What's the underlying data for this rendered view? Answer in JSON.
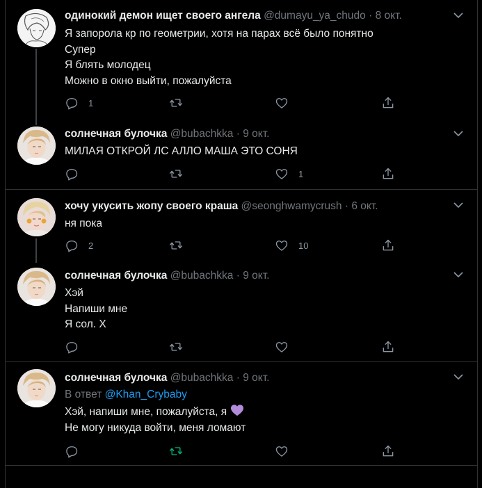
{
  "tweets": [
    {
      "name": "одинокий демон ищет своего ангела",
      "handle": "@dumayu_ya_chudo",
      "dot": "·",
      "date": "8 окт.",
      "lines": [
        "Я запорола кр по геометрии, хотя на парах всё было понятно",
        "Супер",
        "Я блять молодец",
        "Можно в окно выйти, пожалуйста"
      ],
      "reply_count": "1",
      "retweet_count": "",
      "like_count": ""
    },
    {
      "name": "солнечная булочка",
      "handle": "@bubachkka",
      "dot": "·",
      "date": "9 окт.",
      "lines": [
        "МИЛАЯ ОТКРОЙ ЛС АЛЛО МАША ЭТО СОНЯ"
      ],
      "reply_count": "",
      "retweet_count": "",
      "like_count": "1"
    },
    {
      "name": "хочу укусить жопу своего краша",
      "handle": "@seonghwamycrush",
      "dot": "·",
      "date": "6 окт.",
      "lines": [
        "ня пока"
      ],
      "reply_count": "2",
      "retweet_count": "",
      "like_count": "10"
    },
    {
      "name": "солнечная булочка",
      "handle": "@bubachkka",
      "dot": "·",
      "date": "9 окт.",
      "lines": [
        "Хэй",
        "Напиши мне",
        "Я сол. Х"
      ],
      "reply_count": "",
      "retweet_count": "",
      "like_count": ""
    },
    {
      "name": "солнечная булочка",
      "handle": "@bubachkka",
      "dot": "·",
      "date": "9 окт.",
      "reply_prefix": "В ответ",
      "reply_user": "@Khan_Crybaby",
      "lines": [
        "Хэй, напиши мне, пожалуйста, я",
        "Не могу никуда войти, меня ломают"
      ],
      "emoji": "purple-heart",
      "reply_count": "",
      "retweet_count": "",
      "like_count": ""
    }
  ],
  "colors": {
    "background": "#000000",
    "border": "#2f3336",
    "muted": "#71767b",
    "link": "#1d9bf0",
    "retweet_active": "#00ba7c",
    "emoji": "#b38bdb"
  },
  "icons": [
    "reply-icon",
    "retweet-icon",
    "like-icon",
    "share-icon",
    "chevron-down-icon"
  ]
}
